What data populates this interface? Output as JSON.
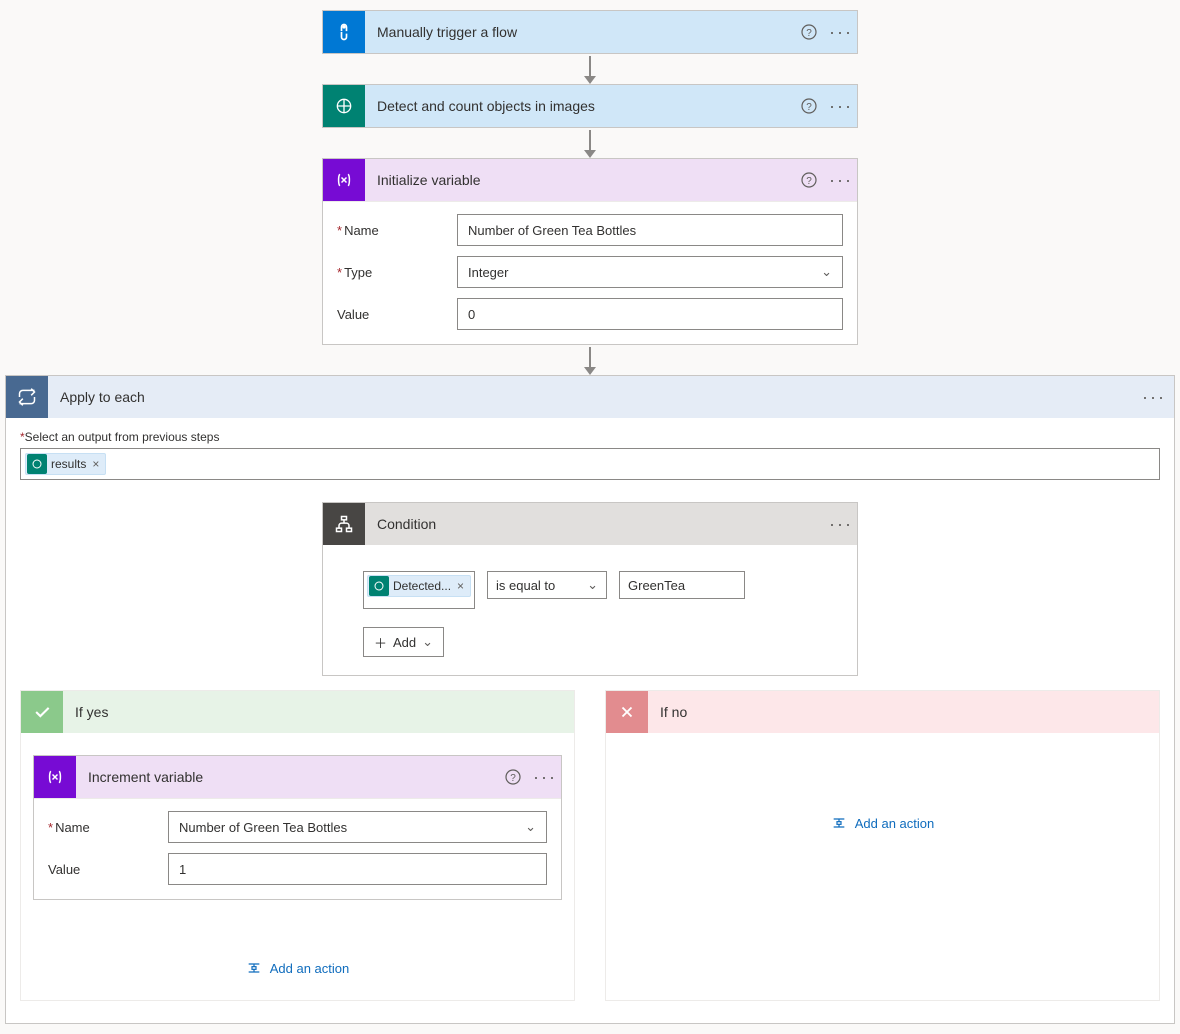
{
  "steps": {
    "trigger": {
      "title": "Manually trigger a flow"
    },
    "detect": {
      "title": "Detect and count objects in images"
    },
    "initvar": {
      "title": "Initialize variable",
      "name_label": "Name",
      "name_value": "Number of Green Tea Bottles",
      "type_label": "Type",
      "type_value": "Integer",
      "value_label": "Value",
      "value_value": "0"
    }
  },
  "loop": {
    "title": "Apply to each",
    "select_label": "Select an output from previous steps",
    "token": "results"
  },
  "condition": {
    "title": "Condition",
    "left_token": "Detected...",
    "operator": "is equal to",
    "right_value": "GreenTea",
    "add_label": "Add"
  },
  "branches": {
    "yes_title": "If yes",
    "no_title": "If no",
    "increment": {
      "title": "Increment variable",
      "name_label": "Name",
      "name_value": "Number of Green Tea Bottles",
      "value_label": "Value",
      "value_value": "1"
    },
    "add_action_label": "Add an action"
  }
}
